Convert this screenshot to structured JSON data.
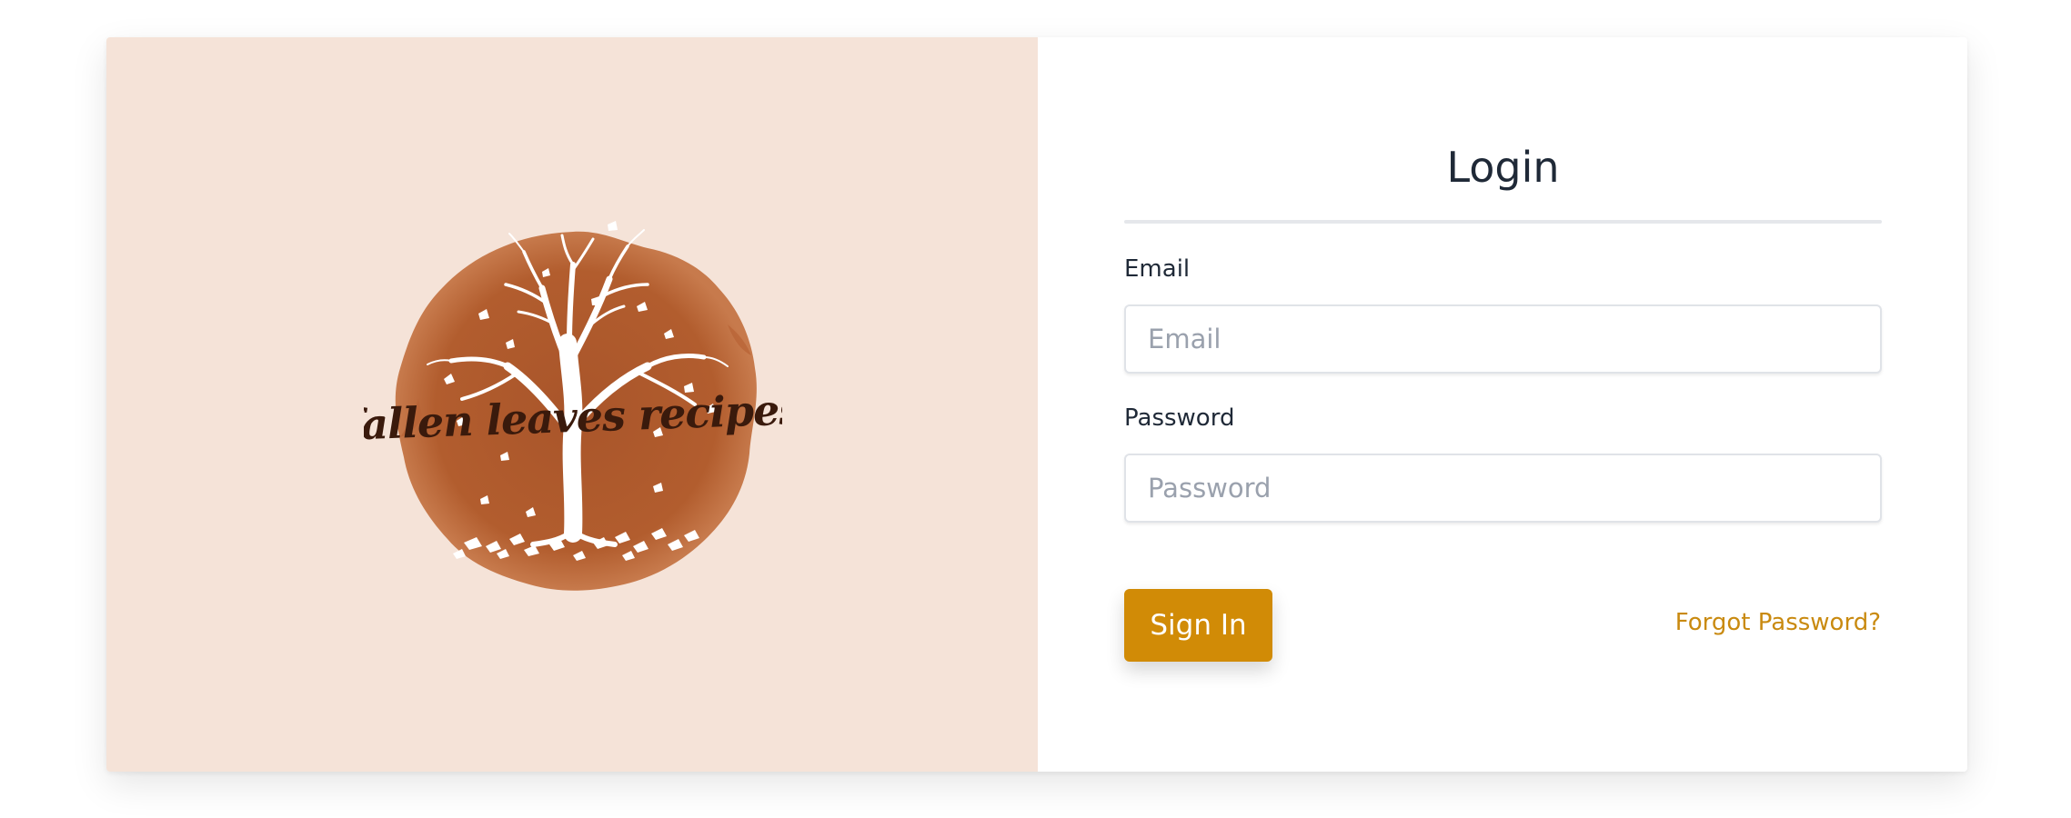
{
  "brand": {
    "logo_text": "fallen leaves recipes",
    "logo_icon": "tree-with-falling-leaves-icon"
  },
  "login": {
    "title": "Login",
    "email_label": "Email",
    "email_placeholder": "Email",
    "email_value": "",
    "password_label": "Password",
    "password_placeholder": "Password",
    "password_value": "",
    "sign_in_label": "Sign In",
    "forgot_password_label": "Forgot Password?"
  },
  "colors": {
    "left_panel_bg": "#f5e3d8",
    "logo_brown": "#b05a2c",
    "accent": "#d18b06",
    "link": "#c98a10"
  }
}
